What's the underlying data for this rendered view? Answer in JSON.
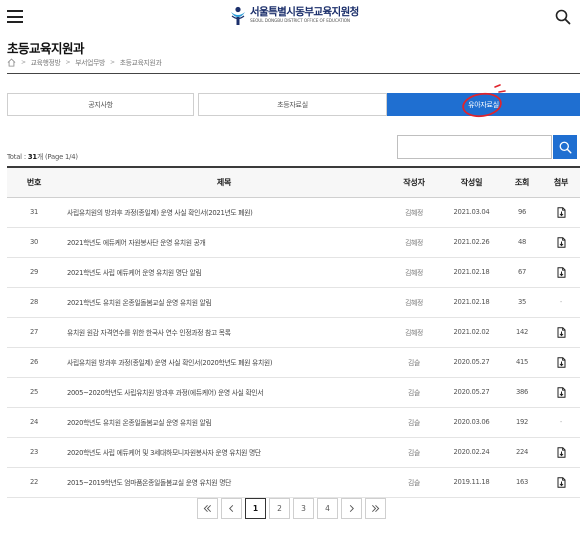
{
  "header": {
    "logo_ko": "서울특별시동부교육지원청",
    "logo_en": "SEOUL DONGBU DISTRICT OFFICE OF EDUCATION",
    "brand_color": "#1b2f6b"
  },
  "page": {
    "title": "초등교육지원과",
    "breadcrumb": [
      "교육행정방",
      "부서업무방",
      "초등교육지원과"
    ]
  },
  "tabs": [
    {
      "label": "공지사항",
      "active": false
    },
    {
      "label": "초등자료실",
      "active": false
    },
    {
      "label": "유아자료실",
      "active": true
    }
  ],
  "accent_color": "#1f6fd1",
  "annotation_color": "#e0242c",
  "listing": {
    "total_prefix": "Total : ",
    "total_count": "31",
    "total_unit": "개",
    "page_info": "(Page 1/4)"
  },
  "search": {
    "placeholder": "",
    "value": ""
  },
  "table": {
    "headers": [
      "번호",
      "제목",
      "작성자",
      "작성일",
      "조회",
      "첨부"
    ],
    "rows": [
      {
        "no": "31",
        "title": "사립유치원의 방과후 과정(종일제) 운영 사실 확인서(2021년도 폐원)",
        "author": "김혜정",
        "date": "2021.03.04",
        "views": "96",
        "attach": "file-icon"
      },
      {
        "no": "30",
        "title": "2021학년도 에듀케어 자원봉사단 운영 유치원 공개",
        "author": "김혜정",
        "date": "2021.02.26",
        "views": "48",
        "attach": "file-icon"
      },
      {
        "no": "29",
        "title": "2021학년도 사립 에듀케어 운영 유치원 명단 알림",
        "author": "김혜정",
        "date": "2021.02.18",
        "views": "67",
        "attach": "file-icon"
      },
      {
        "no": "28",
        "title": "2021학년도 유치원 온종일돌봄교실 운영 유치원 알림",
        "author": "김혜정",
        "date": "2021.02.18",
        "views": "35",
        "attach": "-"
      },
      {
        "no": "27",
        "title": "유치원 원감 자격연수를 위한 한국사 연수 인정과정 참고 목록",
        "author": "김혜정",
        "date": "2021.02.02",
        "views": "142",
        "attach": "file-icon"
      },
      {
        "no": "26",
        "title": "사립유치원 방과후 과정(종일제) 운영 사실 확인서(2020학년도 폐원 유치원)",
        "author": "김슬",
        "date": "2020.05.27",
        "views": "415",
        "attach": "file-icon"
      },
      {
        "no": "25",
        "title": "2005~2020학년도 사립유치원 방과후 과정(에듀케어) 운영 사실 확인서",
        "author": "김슬",
        "date": "2020.05.27",
        "views": "386",
        "attach": "file-icon"
      },
      {
        "no": "24",
        "title": "2020학년도 유치원 온종일돌봄교실 운영 유치원 알림",
        "author": "김슬",
        "date": "2020.03.06",
        "views": "192",
        "attach": "-"
      },
      {
        "no": "23",
        "title": "2020학년도 사립 에듀케어 및 3세대하모니자원봉사자 운영 유치원 명단",
        "author": "김슬",
        "date": "2020.02.24",
        "views": "224",
        "attach": "file-icon"
      },
      {
        "no": "22",
        "title": "2015~2019학년도 엄마품온종일돌봄교실 운영 유치원 명단",
        "author": "김슬",
        "date": "2019.11.18",
        "views": "163",
        "attach": "file-icon"
      }
    ]
  },
  "pagination": {
    "first_icon": "double-chevron-left-icon",
    "prev_icon": "chevron-left-icon",
    "pages": [
      "1",
      "2",
      "3",
      "4"
    ],
    "current": "1",
    "next_icon": "chevron-right-icon",
    "last_icon": "double-chevron-right-icon"
  }
}
